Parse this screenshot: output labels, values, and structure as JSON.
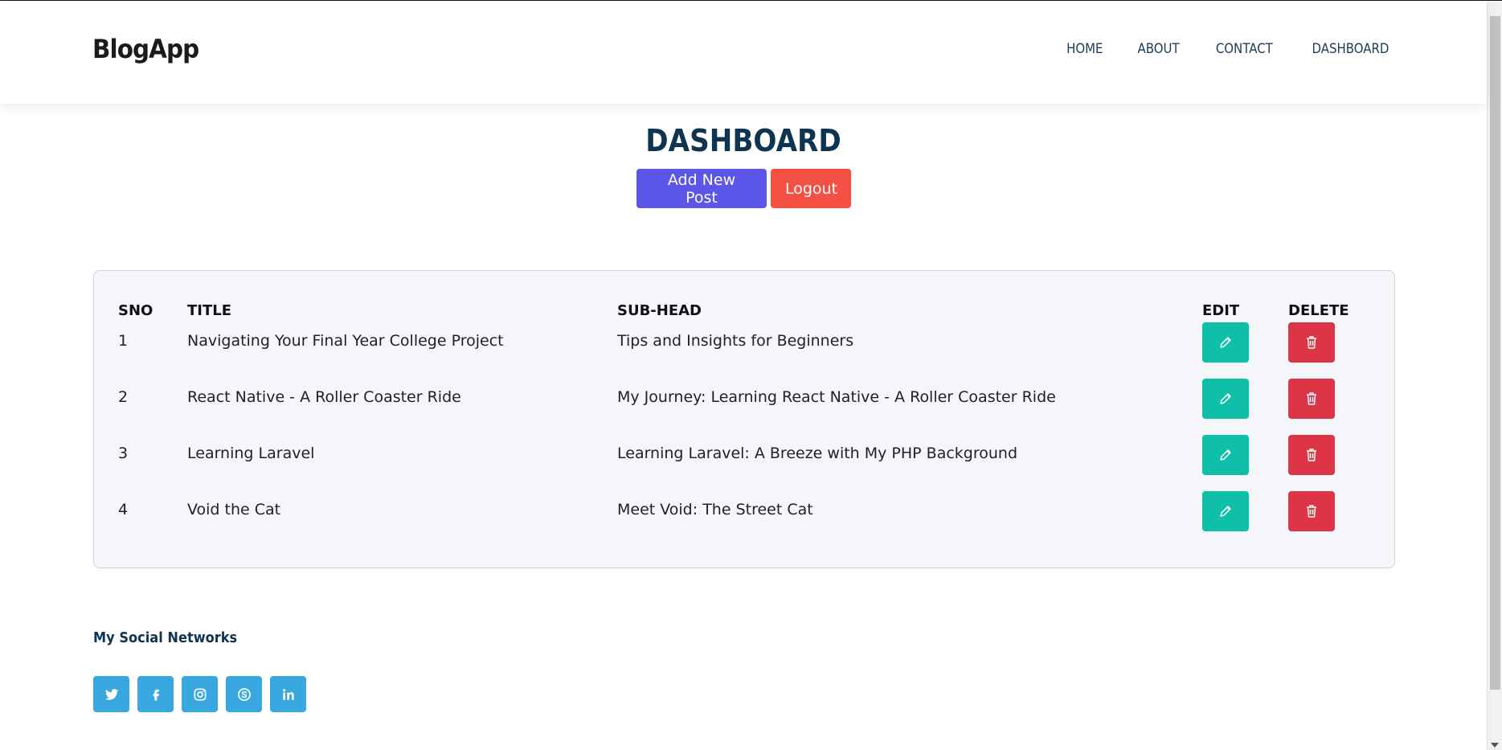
{
  "brand": "BlogApp",
  "nav": [
    "HOME",
    "ABOUT",
    "CONTACT",
    "DASHBOARD"
  ],
  "page_title": "DASHBOARD",
  "actions": {
    "add_label": "Add New Post",
    "logout_label": "Logout"
  },
  "table": {
    "headers": [
      "SNO",
      "TITLE",
      "SUB-HEAD",
      "EDIT",
      "DELETE"
    ],
    "rows": [
      {
        "sno": "1",
        "title": "Navigating Your Final Year College Project",
        "subhead": "Tips and Insights for Beginners"
      },
      {
        "sno": "2",
        "title": "React Native - A Roller Coaster Ride",
        "subhead": "My Journey: Learning React Native - A Roller Coaster Ride"
      },
      {
        "sno": "3",
        "title": "Learning Laravel",
        "subhead": "Learning Laravel: A Breeze with My PHP Background"
      },
      {
        "sno": "4",
        "title": "Void the Cat",
        "subhead": "Meet Void: The Street Cat"
      }
    ],
    "row_icons": {
      "edit": "pencil-icon",
      "delete": "trash-icon"
    }
  },
  "footer": {
    "social_title": "My Social Networks",
    "socials": [
      "twitter-icon",
      "facebook-icon",
      "instagram-icon",
      "skype-icon",
      "linkedin-icon"
    ]
  },
  "colors": {
    "add_button": "#5b55e8",
    "logout_button": "#f55044",
    "edit_button": "#0fbfa8",
    "delete_button": "#dc3545",
    "social_button": "#3aa8e0",
    "title": "#0f3450"
  }
}
